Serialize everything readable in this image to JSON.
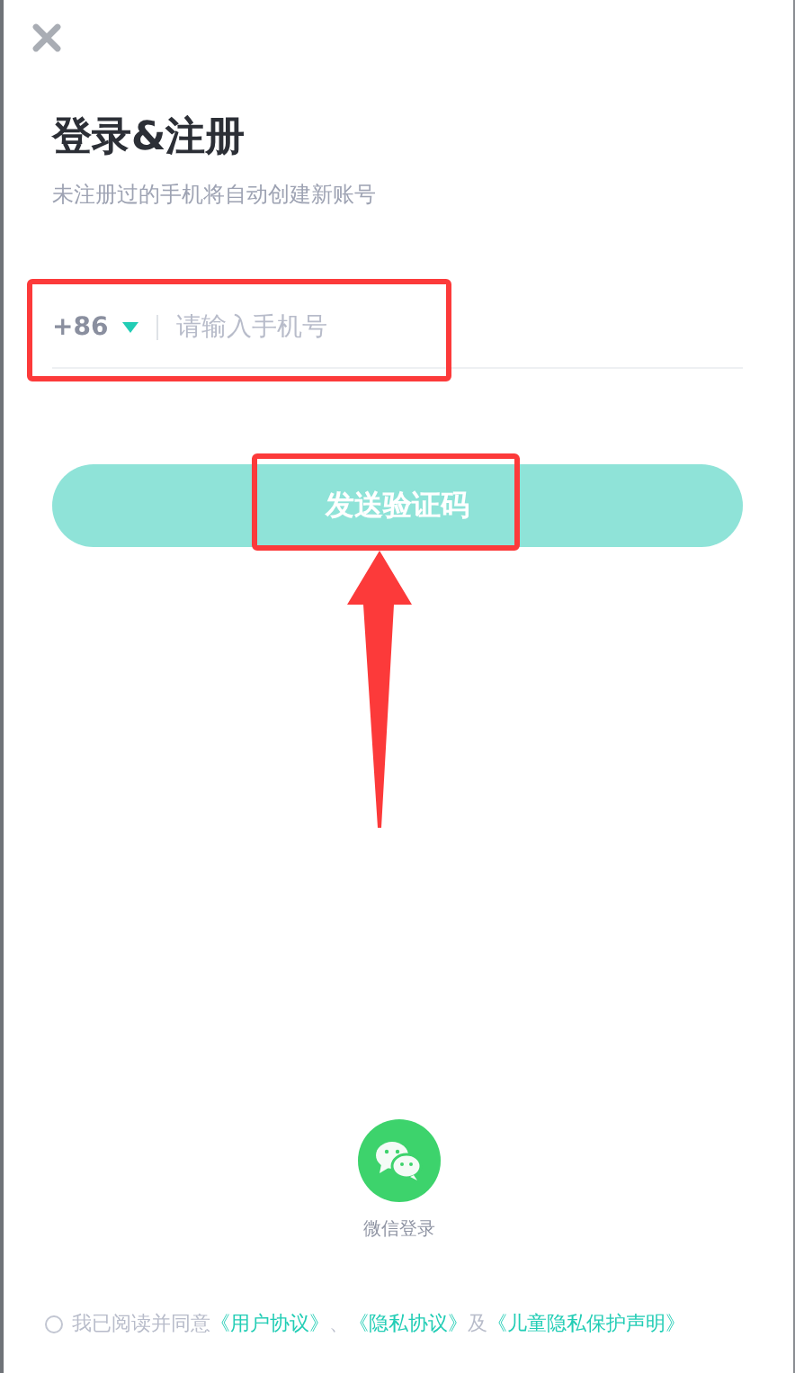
{
  "title": "登录&注册",
  "subtitle": "未注册过的手机将自动创建新账号",
  "phone": {
    "country_code": "+86",
    "placeholder": "请输入手机号",
    "highlighted": true
  },
  "send_button": {
    "label": "发送验证码",
    "disabled": true,
    "highlighted": true,
    "arrow": true
  },
  "wechat": {
    "label": "微信登录"
  },
  "agreement": {
    "checked": false,
    "parts": [
      {
        "kind": "text",
        "text": "我已阅读并同意"
      },
      {
        "kind": "link",
        "text": "《用户协议》"
      },
      {
        "kind": "text",
        "text": "、"
      },
      {
        "kind": "link",
        "text": "《隐私协议》"
      },
      {
        "kind": "text",
        "text": "及"
      },
      {
        "kind": "link",
        "text": "《儿童隐私保护声明》"
      }
    ]
  }
}
